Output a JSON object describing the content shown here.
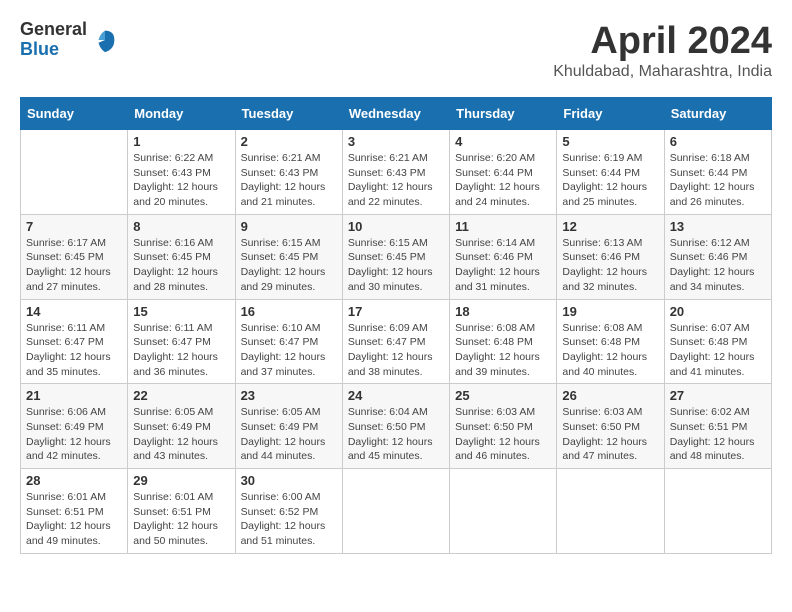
{
  "logo": {
    "general": "General",
    "blue": "Blue"
  },
  "header": {
    "month": "April 2024",
    "location": "Khuldabad, Maharashtra, India"
  },
  "weekdays": [
    "Sunday",
    "Monday",
    "Tuesday",
    "Wednesday",
    "Thursday",
    "Friday",
    "Saturday"
  ],
  "weeks": [
    [
      {
        "day": "",
        "sunrise": "",
        "sunset": "",
        "daylight": ""
      },
      {
        "day": "1",
        "sunrise": "Sunrise: 6:22 AM",
        "sunset": "Sunset: 6:43 PM",
        "daylight": "Daylight: 12 hours and 20 minutes."
      },
      {
        "day": "2",
        "sunrise": "Sunrise: 6:21 AM",
        "sunset": "Sunset: 6:43 PM",
        "daylight": "Daylight: 12 hours and 21 minutes."
      },
      {
        "day": "3",
        "sunrise": "Sunrise: 6:21 AM",
        "sunset": "Sunset: 6:43 PM",
        "daylight": "Daylight: 12 hours and 22 minutes."
      },
      {
        "day": "4",
        "sunrise": "Sunrise: 6:20 AM",
        "sunset": "Sunset: 6:44 PM",
        "daylight": "Daylight: 12 hours and 24 minutes."
      },
      {
        "day": "5",
        "sunrise": "Sunrise: 6:19 AM",
        "sunset": "Sunset: 6:44 PM",
        "daylight": "Daylight: 12 hours and 25 minutes."
      },
      {
        "day": "6",
        "sunrise": "Sunrise: 6:18 AM",
        "sunset": "Sunset: 6:44 PM",
        "daylight": "Daylight: 12 hours and 26 minutes."
      }
    ],
    [
      {
        "day": "7",
        "sunrise": "Sunrise: 6:17 AM",
        "sunset": "Sunset: 6:45 PM",
        "daylight": "Daylight: 12 hours and 27 minutes."
      },
      {
        "day": "8",
        "sunrise": "Sunrise: 6:16 AM",
        "sunset": "Sunset: 6:45 PM",
        "daylight": "Daylight: 12 hours and 28 minutes."
      },
      {
        "day": "9",
        "sunrise": "Sunrise: 6:15 AM",
        "sunset": "Sunset: 6:45 PM",
        "daylight": "Daylight: 12 hours and 29 minutes."
      },
      {
        "day": "10",
        "sunrise": "Sunrise: 6:15 AM",
        "sunset": "Sunset: 6:45 PM",
        "daylight": "Daylight: 12 hours and 30 minutes."
      },
      {
        "day": "11",
        "sunrise": "Sunrise: 6:14 AM",
        "sunset": "Sunset: 6:46 PM",
        "daylight": "Daylight: 12 hours and 31 minutes."
      },
      {
        "day": "12",
        "sunrise": "Sunrise: 6:13 AM",
        "sunset": "Sunset: 6:46 PM",
        "daylight": "Daylight: 12 hours and 32 minutes."
      },
      {
        "day": "13",
        "sunrise": "Sunrise: 6:12 AM",
        "sunset": "Sunset: 6:46 PM",
        "daylight": "Daylight: 12 hours and 34 minutes."
      }
    ],
    [
      {
        "day": "14",
        "sunrise": "Sunrise: 6:11 AM",
        "sunset": "Sunset: 6:47 PM",
        "daylight": "Daylight: 12 hours and 35 minutes."
      },
      {
        "day": "15",
        "sunrise": "Sunrise: 6:11 AM",
        "sunset": "Sunset: 6:47 PM",
        "daylight": "Daylight: 12 hours and 36 minutes."
      },
      {
        "day": "16",
        "sunrise": "Sunrise: 6:10 AM",
        "sunset": "Sunset: 6:47 PM",
        "daylight": "Daylight: 12 hours and 37 minutes."
      },
      {
        "day": "17",
        "sunrise": "Sunrise: 6:09 AM",
        "sunset": "Sunset: 6:47 PM",
        "daylight": "Daylight: 12 hours and 38 minutes."
      },
      {
        "day": "18",
        "sunrise": "Sunrise: 6:08 AM",
        "sunset": "Sunset: 6:48 PM",
        "daylight": "Daylight: 12 hours and 39 minutes."
      },
      {
        "day": "19",
        "sunrise": "Sunrise: 6:08 AM",
        "sunset": "Sunset: 6:48 PM",
        "daylight": "Daylight: 12 hours and 40 minutes."
      },
      {
        "day": "20",
        "sunrise": "Sunrise: 6:07 AM",
        "sunset": "Sunset: 6:48 PM",
        "daylight": "Daylight: 12 hours and 41 minutes."
      }
    ],
    [
      {
        "day": "21",
        "sunrise": "Sunrise: 6:06 AM",
        "sunset": "Sunset: 6:49 PM",
        "daylight": "Daylight: 12 hours and 42 minutes."
      },
      {
        "day": "22",
        "sunrise": "Sunrise: 6:05 AM",
        "sunset": "Sunset: 6:49 PM",
        "daylight": "Daylight: 12 hours and 43 minutes."
      },
      {
        "day": "23",
        "sunrise": "Sunrise: 6:05 AM",
        "sunset": "Sunset: 6:49 PM",
        "daylight": "Daylight: 12 hours and 44 minutes."
      },
      {
        "day": "24",
        "sunrise": "Sunrise: 6:04 AM",
        "sunset": "Sunset: 6:50 PM",
        "daylight": "Daylight: 12 hours and 45 minutes."
      },
      {
        "day": "25",
        "sunrise": "Sunrise: 6:03 AM",
        "sunset": "Sunset: 6:50 PM",
        "daylight": "Daylight: 12 hours and 46 minutes."
      },
      {
        "day": "26",
        "sunrise": "Sunrise: 6:03 AM",
        "sunset": "Sunset: 6:50 PM",
        "daylight": "Daylight: 12 hours and 47 minutes."
      },
      {
        "day": "27",
        "sunrise": "Sunrise: 6:02 AM",
        "sunset": "Sunset: 6:51 PM",
        "daylight": "Daylight: 12 hours and 48 minutes."
      }
    ],
    [
      {
        "day": "28",
        "sunrise": "Sunrise: 6:01 AM",
        "sunset": "Sunset: 6:51 PM",
        "daylight": "Daylight: 12 hours and 49 minutes."
      },
      {
        "day": "29",
        "sunrise": "Sunrise: 6:01 AM",
        "sunset": "Sunset: 6:51 PM",
        "daylight": "Daylight: 12 hours and 50 minutes."
      },
      {
        "day": "30",
        "sunrise": "Sunrise: 6:00 AM",
        "sunset": "Sunset: 6:52 PM",
        "daylight": "Daylight: 12 hours and 51 minutes."
      },
      {
        "day": "",
        "sunrise": "",
        "sunset": "",
        "daylight": ""
      },
      {
        "day": "",
        "sunrise": "",
        "sunset": "",
        "daylight": ""
      },
      {
        "day": "",
        "sunrise": "",
        "sunset": "",
        "daylight": ""
      },
      {
        "day": "",
        "sunrise": "",
        "sunset": "",
        "daylight": ""
      }
    ]
  ]
}
